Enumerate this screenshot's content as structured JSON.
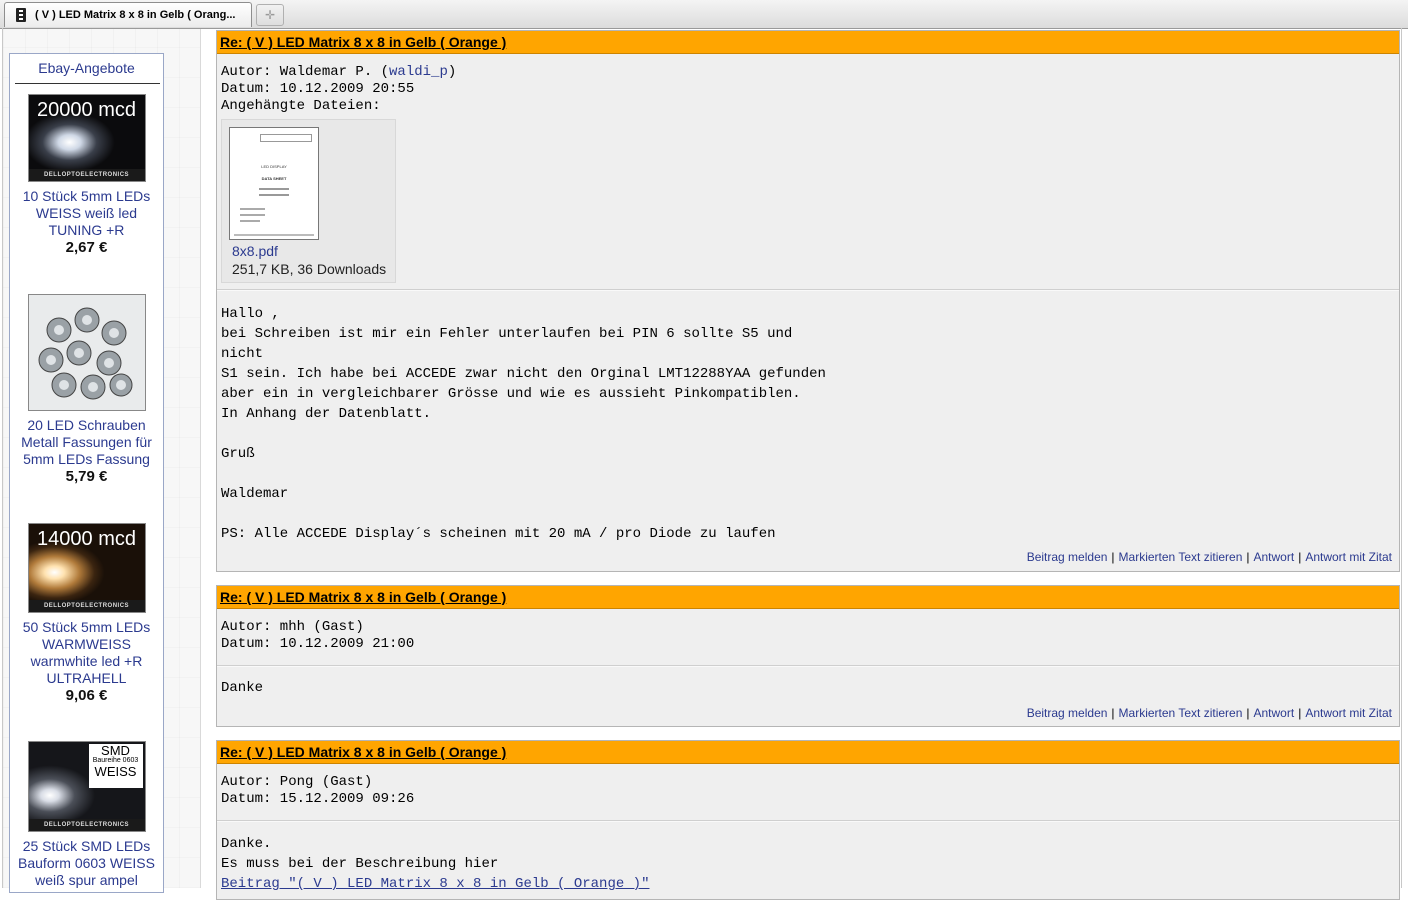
{
  "tab": {
    "title": "( V ) LED Matrix 8 x 8 in Gelb ( Orang..."
  },
  "sidebar": {
    "title": "Ebay-Angebote",
    "ads": [
      {
        "image_text": "20000 mcd",
        "brand": "DELLOPTOELECTRONICS",
        "link": "10 Stück 5mm LEDs WEISS weiß led TUNING +R",
        "price": "2,67 €"
      },
      {
        "link": "20 LED Schrauben Metall Fassungen für 5mm LEDs Fassung",
        "price": "5,79 €"
      },
      {
        "image_text": "14000 mcd",
        "brand": "DELLOPTOELECTRONICS",
        "link": "50 Stück 5mm LEDs WARMWEISS warmwhite led +R ULTRAHELL",
        "price": "9,06 €"
      },
      {
        "image_text_1": "SMD",
        "image_text_2": "Baureihe 0603",
        "image_text_3": "WEISS",
        "brand": "DELLOPTOELECTRONICS",
        "link": "25 Stück SMD LEDs Bauform 0603 WEISS weiß spur ampel"
      }
    ]
  },
  "posts": [
    {
      "title": "Re: ( V ) LED Matrix 8 x 8 in Gelb ( Orange )",
      "author_label": "Autor: Waldemar P. (",
      "author_user": "waldi_p",
      "author_close": ")",
      "date": "Datum: 10.12.2009 20:55",
      "attachments_label": "Angehängte Dateien:",
      "attachment": {
        "thumb_title": "LED DISPLAY",
        "thumb_sub": "DATA SHEET",
        "name": "8x8.pdf",
        "info": "251,7 KB, 36 Downloads"
      },
      "body": "Hallo ,\nbei Schreiben ist mir ein Fehler unterlaufen bei PIN 6 sollte S5 und\nnicht\nS1 sein. Ich habe bei ACCEDE zwar nicht den Orginal LMT12288YAA gefunden\naber ein in vergleichbarer Grösse und wie es aussieht Pinkompatiblen.\nIn Anhang der Datenblatt.\n\nGruß\n\nWaldemar\n\nPS: Alle ACCEDE Display´s scheinen mit 20 mA / pro Diode zu laufen"
    },
    {
      "title": "Re: ( V ) LED Matrix 8 x 8 in Gelb ( Orange )",
      "author": "Autor: mhh (Gast)",
      "date": "Datum: 10.12.2009 21:00",
      "body": "Danke"
    },
    {
      "title": "Re: ( V ) LED Matrix 8 x 8 in Gelb ( Orange )",
      "author": "Autor: Pong (Gast)",
      "date": "Datum: 15.12.2009 09:26",
      "body": "Danke.\nEs muss bei der Beschreibung hier",
      "body_link": "Beitrag \"( V ) LED Matrix 8 x 8 in Gelb ( Orange )\""
    }
  ],
  "actions": {
    "report": "Beitrag melden",
    "quote_selected": "Markierten Text zitieren",
    "reply": "Antwort",
    "reply_quote": "Antwort mit Zitat",
    "separator": "|"
  },
  "colors": {
    "header": "#ffa500",
    "link": "#2b3a8f",
    "post_bg": "#efefef"
  }
}
